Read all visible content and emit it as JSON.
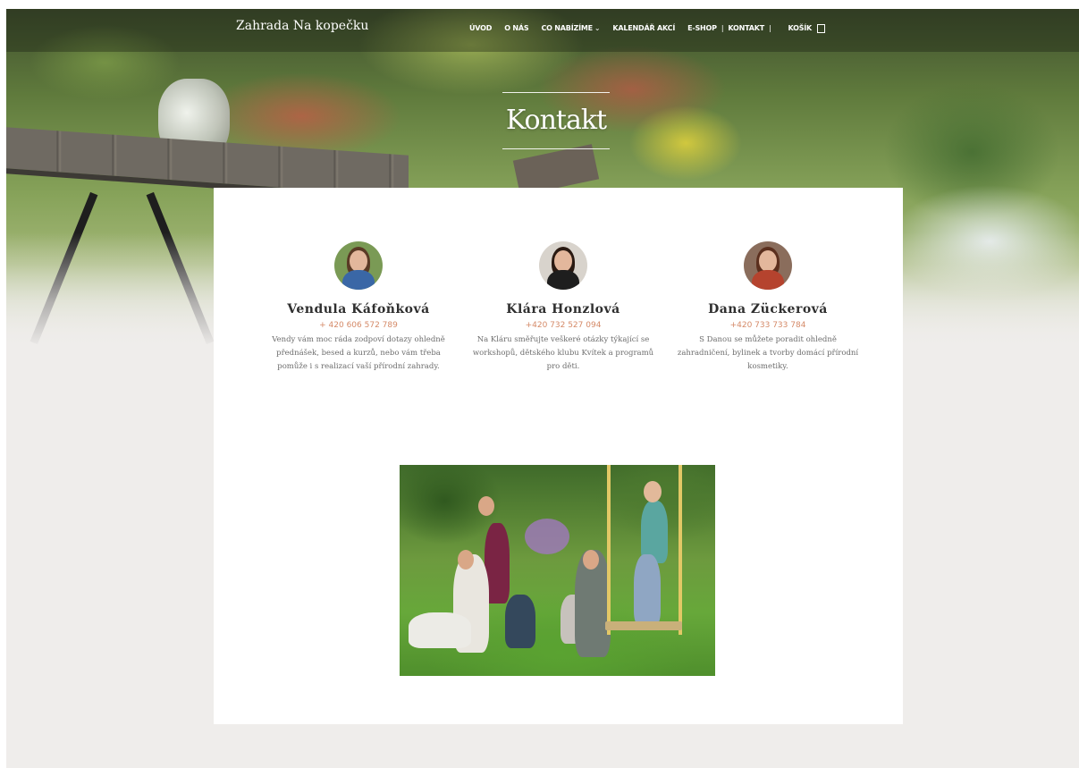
{
  "brand": "Zahrada Na kopečku",
  "nav": {
    "items": [
      "ÚVOD",
      "O NÁS",
      "CO NABÍZÍME",
      "KALENDÁŘ AKCÍ",
      "E-SHOP",
      "KONTAKT"
    ],
    "cart": "KOŠÍK"
  },
  "page_title": "Kontakt",
  "people": [
    {
      "name": "Vendula Káfoňková",
      "phone": "+ 420 606 572 789",
      "description": "Vendy vám moc ráda zodpoví dotazy ohledně přednášek, besed a kurzů, nebo vám třeba pomůže i s realizací vaší přírodní zahrady."
    },
    {
      "name": "Klára Honzlová",
      "phone": "+420 732 527 094",
      "description": "Na Kláru směřujte veškeré otázky týkající se workshopů, dětského klubu Kvítek a programů pro děti."
    },
    {
      "name": "Dana Zückerová",
      "phone": "+420 733 733 784",
      "description": "S Danou se můžete poradit ohledně zahradničení, bylinek a tvorby domácí přírodní kosmetiky."
    }
  ],
  "colors": {
    "accent_phone": "#d58a68",
    "page_bg": "#efedeb",
    "card_bg": "#ffffff"
  }
}
